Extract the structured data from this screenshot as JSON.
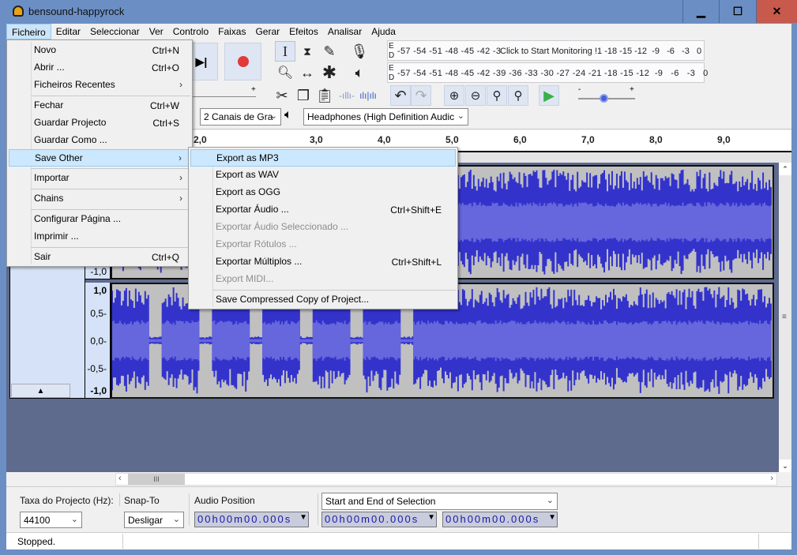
{
  "window": {
    "title": "bensound-happyrock",
    "minimize": "▁",
    "maximize": "☐",
    "close": "✕"
  },
  "menubar": [
    "Ficheiro",
    "Editar",
    "Seleccionar",
    "Ver",
    "Controlo",
    "Faixas",
    "Gerar",
    "Efeitos",
    "Analisar",
    "Ajuda"
  ],
  "file_menu": {
    "items": [
      {
        "label": "Novo",
        "shortcut": "Ctrl+N"
      },
      {
        "label": "Abrir ...",
        "shortcut": "Ctrl+O"
      },
      {
        "label": "Ficheiros Recentes",
        "submenu": true
      },
      {
        "label": "Fechar",
        "shortcut": "Ctrl+W"
      },
      {
        "label": "Guardar Projecto",
        "shortcut": "Ctrl+S"
      },
      {
        "label": "Guardar Como ..."
      },
      {
        "label": "Save Other",
        "submenu": true,
        "highlighted": true
      },
      {
        "label": "Importar",
        "submenu": true
      },
      {
        "label": "Chains",
        "submenu": true
      },
      {
        "label": "Configurar Página ..."
      },
      {
        "label": "Imprimir ..."
      },
      {
        "label": "Sair",
        "shortcut": "Ctrl+Q"
      }
    ],
    "arrow": "›"
  },
  "save_other_menu": {
    "items": [
      {
        "label": "Export as MP3",
        "highlighted": true
      },
      {
        "label": "Export as WAV"
      },
      {
        "label": "Export as OGG"
      },
      {
        "label": "Exportar Áudio ...",
        "shortcut": "Ctrl+Shift+E"
      },
      {
        "label": "Exportar Áudio Seleccionado ...",
        "disabled": true
      },
      {
        "label": "Exportar Rótulos ...",
        "disabled": true
      },
      {
        "label": "Exportar Múltiplos ...",
        "shortcut": "Ctrl+Shift+L"
      },
      {
        "label": "Export MIDI...",
        "disabled": true
      },
      {
        "label": "Save Compressed Copy of Project..."
      }
    ]
  },
  "toolbar": {
    "meters": {
      "record_ticks": "-57 -54 -51 -48 -45 -42 -3",
      "record_hint": "Click to Start Monitoring",
      "record_ticks_right": "!1 -18 -15 -12  -9   -6   -3   0",
      "playback_ticks": "-57 -54 -51 -48 -45 -42 -39 -36 -33 -30 -27 -24 -21 -18 -15 -12  -9   -6   -3   0",
      "channel_left": "E",
      "channel_right": "D"
    },
    "slider_minus": "-",
    "slider_plus": "+",
    "playback_speed": 0.33,
    "recording_channels": "2 Canais de Gra",
    "playback_device": "Headphones (High Definition Audic",
    "chevron": "⌄"
  },
  "ruler": {
    "ticks": [
      "2,0",
      "3,0",
      "4,0",
      "5,0",
      "6,0",
      "7,0",
      "8,0",
      "9,0"
    ]
  },
  "track": {
    "scale_top": [
      "-1,0"
    ],
    "scale_bottom": [
      "1,0",
      "0,5-",
      "0,0-",
      "-0,5-",
      "-1,0"
    ],
    "collapse": "▲",
    "wave_color": "#3333cc",
    "rms_color": "#6666dd"
  },
  "selection_toolbar": {
    "project_rate_label": "Taxa do Projecto (Hz):",
    "project_rate": "44100",
    "snap_label": "Snap-To",
    "snap_value": "Desligar",
    "audio_position_label": "Audio Position",
    "audio_position": "00h00m00.000s",
    "selection_mode": "Start and End of Selection",
    "selection_start": "00h00m00.000s",
    "selection_end": "00h00m00.000s"
  },
  "status": {
    "text": "Stopped."
  }
}
